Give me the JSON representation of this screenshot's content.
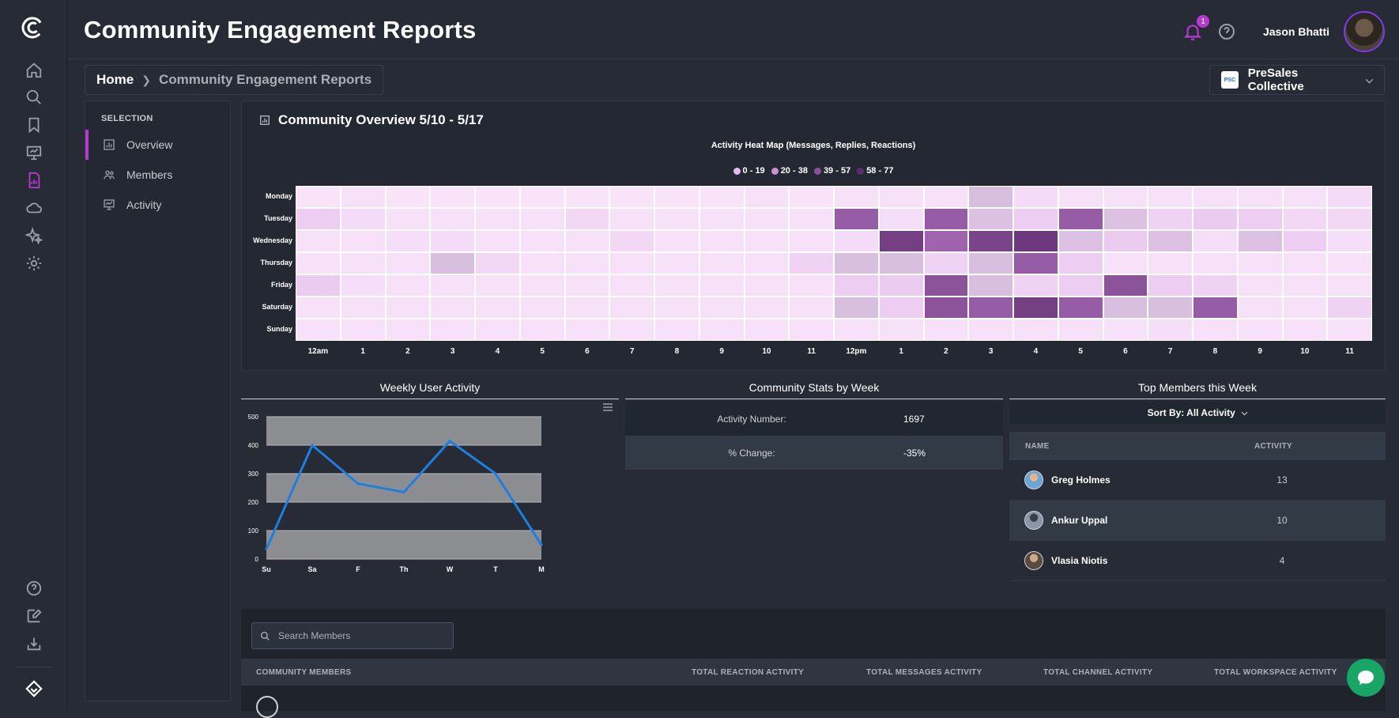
{
  "page": {
    "title": "Community Engagement Reports"
  },
  "header": {
    "user_name": "Jason Bhatti",
    "notification_count": "1"
  },
  "breadcrumb": {
    "home": "Home",
    "current": "Community Engagement Reports"
  },
  "org_selector": {
    "name": "PreSales Collective",
    "logo_text": "PSC"
  },
  "selection": {
    "heading": "SELECTION",
    "items": [
      {
        "label": "Overview",
        "icon": "chart-icon",
        "active": true
      },
      {
        "label": "Members",
        "icon": "members-icon",
        "active": false
      },
      {
        "label": "Activity",
        "icon": "activity-icon",
        "active": false
      }
    ]
  },
  "overview": {
    "title": "Community Overview 5/10 - 5/17",
    "heatmap": {
      "title": "Activity Heat Map (Messages, Replies, Reactions)",
      "legend": [
        {
          "label": "0 - 19",
          "color": "#e7b8ef"
        },
        {
          "label": "20 - 38",
          "color": "#c891d4"
        },
        {
          "label": "39 - 57",
          "color": "#8e4ea0"
        },
        {
          "label": "58 - 77",
          "color": "#5e2d6b"
        }
      ],
      "days": [
        "Monday",
        "Tuesday",
        "Wednesday",
        "Thursday",
        "Friday",
        "Saturday",
        "Sunday"
      ],
      "hours": [
        "12am",
        "1",
        "2",
        "3",
        "4",
        "5",
        "6",
        "7",
        "8",
        "9",
        "10",
        "11",
        "12pm",
        "1",
        "2",
        "3",
        "4",
        "5",
        "6",
        "7",
        "8",
        "9",
        "10",
        "11"
      ]
    }
  },
  "chart_data": {
    "type": "heatmap",
    "title": "Activity Heat Map (Messages, Replies, Reactions)",
    "rows": [
      "Monday",
      "Tuesday",
      "Wednesday",
      "Thursday",
      "Friday",
      "Saturday",
      "Sunday"
    ],
    "columns": [
      "12am",
      "1",
      "2",
      "3",
      "4",
      "5",
      "6",
      "7",
      "8",
      "9",
      "10",
      "11",
      "12pm",
      "1",
      "2",
      "3",
      "4",
      "5",
      "6",
      "7",
      "8",
      "9",
      "10",
      "11"
    ],
    "bins": [
      "0 - 19",
      "20 - 38",
      "39 - 57",
      "58 - 77"
    ],
    "values": [
      [
        2,
        3,
        2,
        2,
        2,
        2,
        2,
        2,
        2,
        2,
        3,
        2,
        3,
        3,
        3,
        25,
        5,
        3,
        3,
        3,
        3,
        3,
        3,
        5
      ],
      [
        10,
        5,
        3,
        3,
        3,
        3,
        6,
        3,
        3,
        3,
        3,
        3,
        50,
        4,
        50,
        22,
        10,
        50,
        22,
        8,
        12,
        10,
        6,
        6
      ],
      [
        3,
        3,
        4,
        5,
        3,
        3,
        3,
        6,
        3,
        3,
        3,
        3,
        5,
        68,
        45,
        65,
        72,
        22,
        12,
        22,
        4,
        22,
        10,
        4
      ],
      [
        3,
        3,
        3,
        24,
        6,
        3,
        3,
        3,
        3,
        3,
        3,
        8,
        24,
        24,
        8,
        24,
        50,
        10,
        3,
        3,
        3,
        3,
        3,
        3
      ],
      [
        12,
        4,
        3,
        3,
        3,
        3,
        3,
        3,
        3,
        3,
        3,
        3,
        10,
        12,
        55,
        24,
        8,
        10,
        55,
        10,
        8,
        3,
        3,
        3
      ],
      [
        3,
        3,
        3,
        3,
        3,
        3,
        3,
        3,
        3,
        3,
        3,
        3,
        24,
        10,
        55,
        50,
        68,
        50,
        24,
        24,
        50,
        3,
        3,
        8
      ],
      [
        3,
        3,
        3,
        3,
        3,
        3,
        3,
        3,
        3,
        3,
        3,
        3,
        3,
        3,
        3,
        3,
        3,
        3,
        3,
        4,
        3,
        3,
        3,
        3
      ]
    ]
  },
  "weekly_activity": {
    "title": "Weekly User Activity",
    "type": "line",
    "categories": [
      "Su",
      "Sa",
      "F",
      "Th",
      "W",
      "T",
      "M"
    ],
    "values": [
      35,
      400,
      265,
      235,
      415,
      300,
      50
    ],
    "yticks": [
      "0",
      "100",
      "200",
      "300",
      "400",
      "500"
    ],
    "ylim": [
      0,
      500
    ],
    "line_color": "#1f7fe0"
  },
  "community_stats": {
    "title": "Community Stats by Week",
    "rows": [
      {
        "label": "Activity Number:",
        "value": "1697"
      },
      {
        "label": "% Change:",
        "value": "-35%"
      }
    ]
  },
  "top_members": {
    "title": "Top Members this Week",
    "sort_label": "Sort By: All Activity",
    "columns": {
      "name": "NAME",
      "activity": "ACTIVITY"
    },
    "rows": [
      {
        "name": "Greg Holmes",
        "activity": "13"
      },
      {
        "name": "Ankur Uppal",
        "activity": "10"
      },
      {
        "name": "Vlasia Niotis",
        "activity": "4"
      }
    ]
  },
  "members_table": {
    "search_placeholder": "Search Members",
    "columns": [
      "COMMUNITY MEMBERS",
      "TOTAL REACTION ACTIVITY",
      "TOTAL MESSAGES ACTIVITY",
      "TOTAL CHANNEL ACTIVITY",
      "TOTAL WORKSPACE ACTIVITY"
    ]
  }
}
